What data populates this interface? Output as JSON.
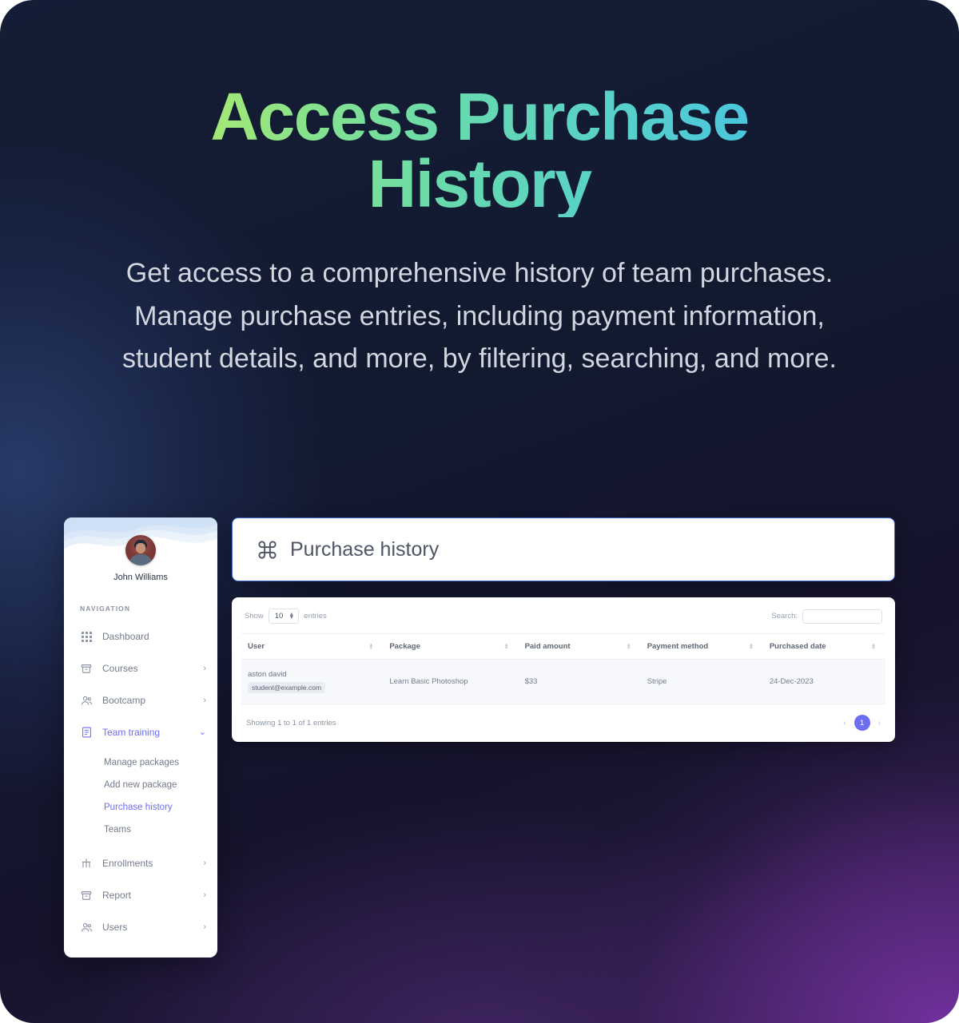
{
  "hero": {
    "title": "Access Purchase History",
    "subtitle": "Get access to a comprehensive history of team purchases. Manage purchase entries, including payment information, student details, and more, by filtering, searching, and more.",
    "title_gradient_start": "#d6f24f",
    "title_gradient_end": "#3bb4ea"
  },
  "sidebar": {
    "profile_name": "John Williams",
    "nav_label": "NAVIGATION",
    "accent_color": "#6c6ef2",
    "items": [
      {
        "label": "Dashboard",
        "icon": "grid-icon",
        "chevron": "",
        "active": false
      },
      {
        "label": "Courses",
        "icon": "archive-icon",
        "chevron": "›",
        "active": false
      },
      {
        "label": "Bootcamp",
        "icon": "people-icon",
        "chevron": "›",
        "active": false
      },
      {
        "label": "Team training",
        "icon": "document-icon",
        "chevron": "⌄",
        "active": true
      },
      {
        "label": "Enrollments",
        "icon": "bar-chart-icon",
        "chevron": "›",
        "active": false
      },
      {
        "label": "Report",
        "icon": "archive-icon",
        "chevron": "›",
        "active": false
      },
      {
        "label": "Users",
        "icon": "people-icon",
        "chevron": "›",
        "active": false
      }
    ],
    "subitems": [
      {
        "label": "Manage packages",
        "active": false
      },
      {
        "label": "Add new package",
        "active": false
      },
      {
        "label": "Purchase history",
        "active": true
      },
      {
        "label": "Teams",
        "active": false
      }
    ]
  },
  "panel": {
    "title": "Purchase history",
    "icon": "command-icon"
  },
  "table": {
    "show_label": "Show",
    "entries_label": "entries",
    "page_length": "10",
    "search_label": "Search:",
    "search_value": "",
    "search_placeholder": "",
    "columns": [
      {
        "label": "User",
        "sortable": true
      },
      {
        "label": "Package",
        "sortable": true
      },
      {
        "label": "Paid amount",
        "sortable": true
      },
      {
        "label": "Payment method",
        "sortable": true
      },
      {
        "label": "Purchased date",
        "sortable": true
      }
    ],
    "rows": [
      {
        "user_name": "aston david",
        "user_email": "student@example.com",
        "package": "Learn Basic Photoshop",
        "paid_amount": "$33",
        "payment_method": "Stripe",
        "purchased_date": "24-Dec-2023"
      }
    ],
    "info": "Showing 1 to 1 of 1 entries",
    "pagination": {
      "prev": "‹",
      "next": "›",
      "current_page": "1",
      "active_color": "#6c6ef2"
    }
  }
}
